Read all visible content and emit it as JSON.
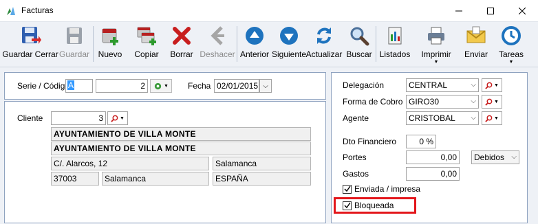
{
  "window": {
    "title": "Facturas"
  },
  "toolbar": {
    "buttons": [
      {
        "label": "Guardar Cerrar",
        "icon": "save-icon"
      },
      {
        "label": "Guardar",
        "icon": "save-disabled-icon"
      },
      {
        "label": "Nuevo",
        "icon": "new-icon"
      },
      {
        "label": "Copiar",
        "icon": "copy-icon"
      },
      {
        "label": "Borrar",
        "icon": "delete-icon"
      },
      {
        "label": "Deshacer",
        "icon": "undo-icon"
      },
      {
        "label": "Anterior",
        "icon": "up-arrow-icon"
      },
      {
        "label": "Siguiente",
        "icon": "down-arrow-icon"
      },
      {
        "label": "Actualizar",
        "icon": "refresh-icon"
      },
      {
        "label": "Buscar",
        "icon": "search-icon"
      },
      {
        "label": "Listados",
        "icon": "report-icon"
      },
      {
        "label": "Imprimir",
        "icon": "printer-icon"
      },
      {
        "label": "Enviar",
        "icon": "mail-icon"
      },
      {
        "label": "Tareas",
        "icon": "clock-icon"
      }
    ]
  },
  "header": {
    "serie_label": "Serie / Código",
    "serie_value": "A",
    "codigo_value": "2",
    "fecha_label": "Fecha",
    "fecha_value": "02/01/2015"
  },
  "cliente": {
    "label": "Cliente",
    "code": "3",
    "name1": "AYUNTAMIENTO DE VILLA MONTE",
    "name2": "AYUNTAMIENTO DE VILLA MONTE",
    "address": "C/. Alarcos, 12",
    "city_right": "Salamanca",
    "postal": "37003",
    "city": "Salamanca",
    "country": "ESPAÑA"
  },
  "right": {
    "delegacion_label": "Delegación",
    "delegacion_value": "CENTRAL",
    "forma_cobro_label": "Forma de Cobro",
    "forma_cobro_value": "GIRO30",
    "agente_label": "Agente",
    "agente_value": "CRISTOBAL",
    "dto_label": "Dto Financiero",
    "dto_value": "0 %",
    "portes_label": "Portes",
    "portes_value": "0,00",
    "portes_type": "Debidos",
    "gastos_label": "Gastos",
    "gastos_value": "0,00",
    "enviada_label": "Enviada / impresa",
    "enviada_checked": true,
    "bloqueada_label": "Bloqueada",
    "bloqueada_checked": true
  },
  "colors": {
    "highlight": "#e3161b",
    "accent": "#1e73be"
  }
}
